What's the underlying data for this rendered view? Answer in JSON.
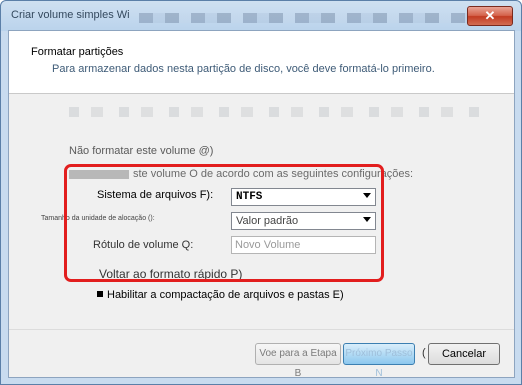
{
  "window": {
    "title": "Criar volume simples Wi",
    "close_glyph": "✕"
  },
  "header": {
    "title": "Formatar partições",
    "subtitle": "Para armazenar dados nesta partição de disco, você deve formatá-lo primeiro."
  },
  "options": {
    "no_format_label": "Não formatar este volume @)",
    "format_label": "ste volume O de acordo com as seguintes configurações:"
  },
  "fields": {
    "filesystem_label": "Sistema de arquivos F):",
    "filesystem_value": "NTFS",
    "allocation_label": "Tamanho da unidade de alocação ():",
    "allocation_value": "Valor padrão",
    "volume_label_label": "Rótulo de volume Q:",
    "volume_label_placeholder": "Novo Volume",
    "quick_format_label": "Voltar ao formato rápido P)",
    "compress_label": "Habilitar a compactação de arquivos e pastas E)"
  },
  "buttons": {
    "back": "Voe para a Etapa B",
    "next": "Próximo Passo N",
    "next_paren": "(",
    "cancel": "Cancelar"
  },
  "colors": {
    "highlight": "#e21e1e",
    "title_bar": "#bad3ec",
    "close_button": "#c23b22"
  }
}
